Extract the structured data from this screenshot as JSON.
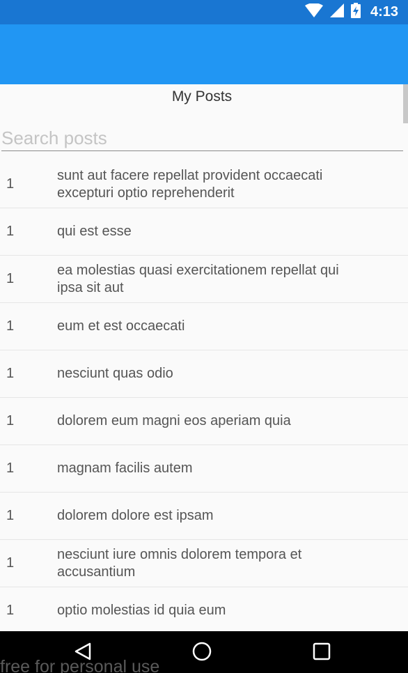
{
  "status_bar": {
    "time": "4:13",
    "icons": [
      "wifi-icon",
      "signal-icon",
      "battery-charging-icon"
    ]
  },
  "page": {
    "title": "My Posts"
  },
  "search": {
    "placeholder": "Search posts",
    "value": ""
  },
  "posts": [
    {
      "id": "1",
      "title": "sunt aut facere repellat provident occaecati excepturi optio reprehenderit"
    },
    {
      "id": "1",
      "title": "qui est esse"
    },
    {
      "id": "1",
      "title": "ea molestias quasi exercitationem repellat qui ipsa sit aut"
    },
    {
      "id": "1",
      "title": "eum et est occaecati"
    },
    {
      "id": "1",
      "title": "nesciunt quas odio"
    },
    {
      "id": "1",
      "title": "dolorem eum magni eos aperiam quia"
    },
    {
      "id": "1",
      "title": "magnam facilis autem"
    },
    {
      "id": "1",
      "title": "dolorem dolore est ipsam"
    },
    {
      "id": "1",
      "title": "nesciunt iure omnis dolorem tempora et accusantium"
    },
    {
      "id": "1",
      "title": "optio molestias id quia eum"
    }
  ],
  "nav_bar": {
    "icons": [
      "back-icon",
      "home-icon",
      "recents-icon"
    ]
  },
  "watermark": "free for personal use",
  "colors": {
    "status_bar": "#1976d2",
    "app_bar": "#2196f3",
    "background": "#fafafa",
    "nav_bar": "#000000"
  }
}
